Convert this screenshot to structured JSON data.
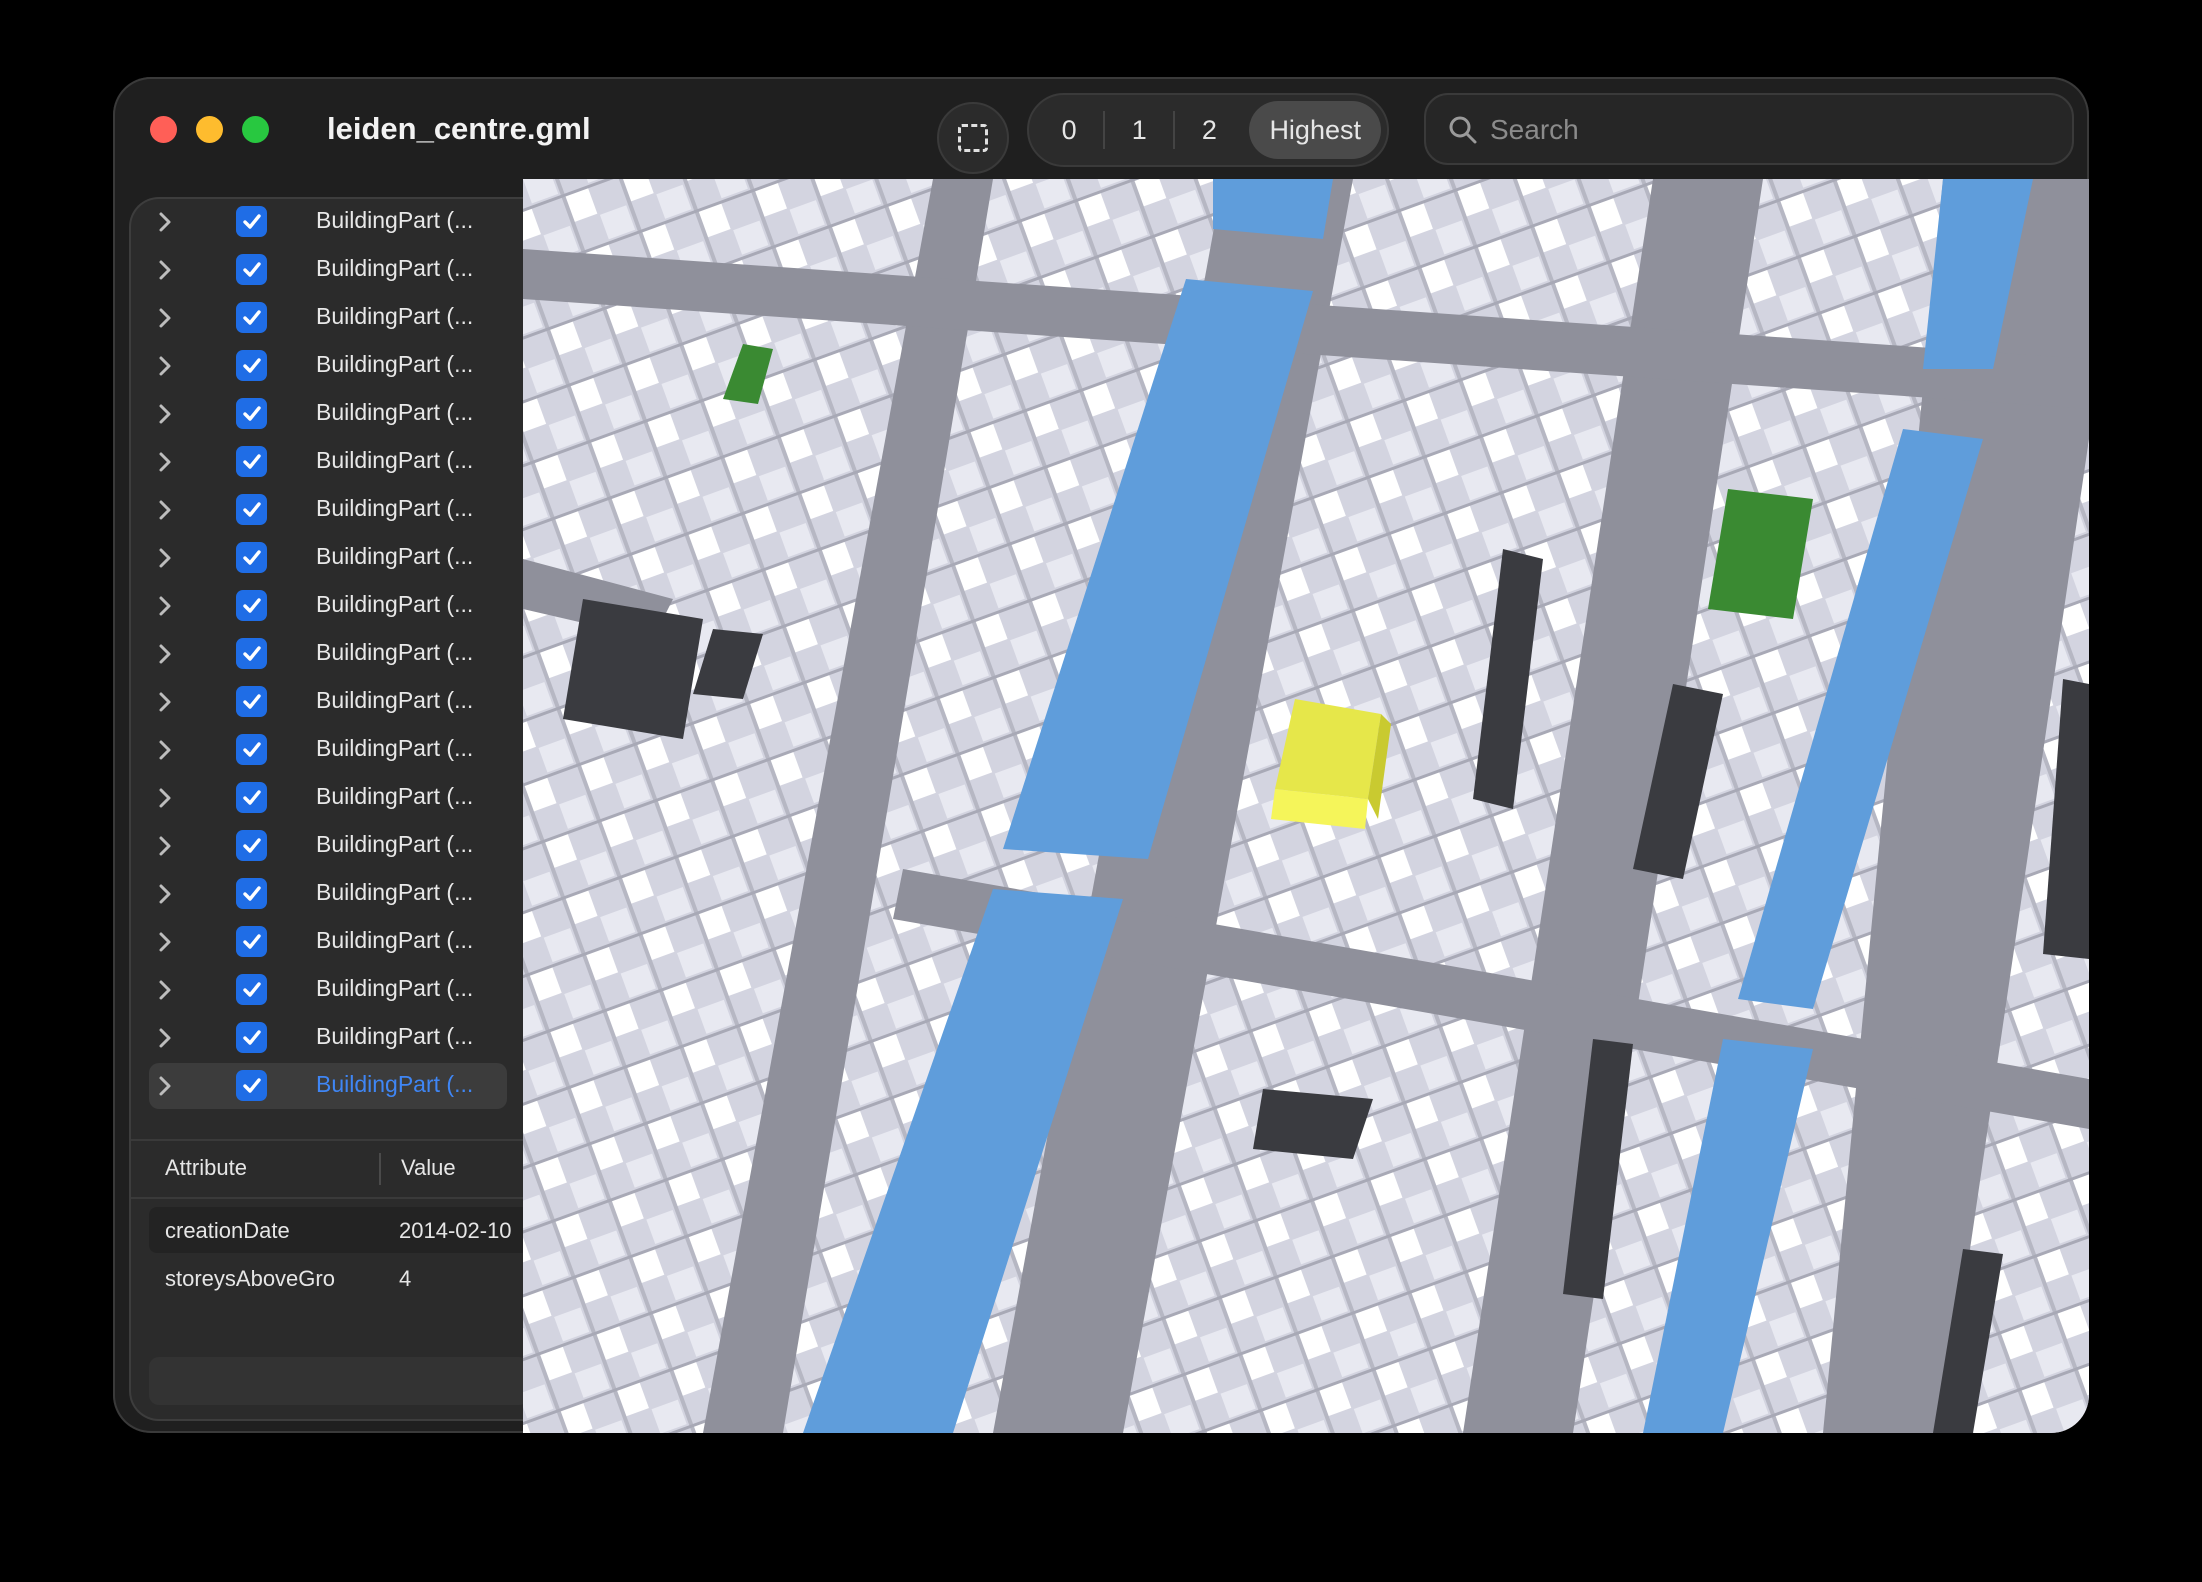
{
  "window": {
    "title": "leiden_centre.gml"
  },
  "toolbar": {
    "lod_options": [
      "0",
      "1",
      "2",
      "Highest"
    ],
    "lod_selected": "Highest",
    "search_placeholder": "Search"
  },
  "tree": {
    "items": [
      {
        "label": "BuildingPart (...",
        "checked": true
      },
      {
        "label": "BuildingPart (...",
        "checked": true
      },
      {
        "label": "BuildingPart (...",
        "checked": true
      },
      {
        "label": "BuildingPart (...",
        "checked": true
      },
      {
        "label": "BuildingPart (...",
        "checked": true
      },
      {
        "label": "BuildingPart (...",
        "checked": true
      },
      {
        "label": "BuildingPart (...",
        "checked": true
      },
      {
        "label": "BuildingPart (...",
        "checked": true
      },
      {
        "label": "BuildingPart (...",
        "checked": true
      },
      {
        "label": "BuildingPart (...",
        "checked": true
      },
      {
        "label": "BuildingPart (...",
        "checked": true
      },
      {
        "label": "BuildingPart (...",
        "checked": true
      },
      {
        "label": "BuildingPart (...",
        "checked": true
      },
      {
        "label": "BuildingPart (...",
        "checked": true
      },
      {
        "label": "BuildingPart (...",
        "checked": true
      },
      {
        "label": "BuildingPart (...",
        "checked": true
      },
      {
        "label": "BuildingPart (...",
        "checked": true
      },
      {
        "label": "BuildingPart (...",
        "checked": true
      },
      {
        "label": "BuildingPart (...",
        "checked": true,
        "selected": true
      }
    ]
  },
  "attributes": {
    "header_attribute": "Attribute",
    "header_value": "Value",
    "rows": [
      {
        "key": "creationDate",
        "value": "2014-02-10"
      },
      {
        "key": "storeysAboveGro",
        "value": "4"
      }
    ]
  },
  "colors": {
    "canal": "#5f9ddb",
    "building_roof": "#d4d5e2",
    "street": "#8f909b",
    "park": "#3a8a32",
    "highlight": "#d8d93a",
    "courtyard": "#3a3b40",
    "accent": "#1f6de6"
  }
}
